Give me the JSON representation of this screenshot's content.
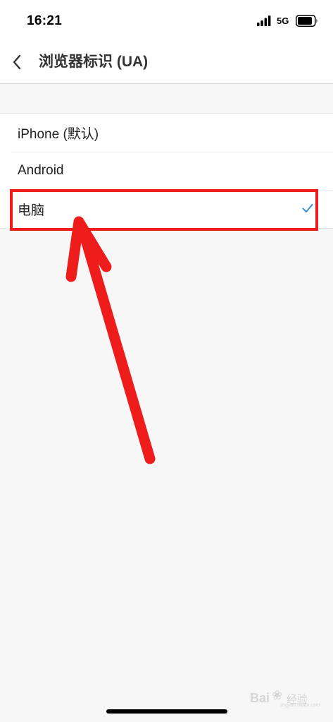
{
  "status_bar": {
    "time": "16:21",
    "network": "5G",
    "signal_icon": "cellular-signal-icon",
    "battery_icon": "battery-icon"
  },
  "nav": {
    "back_icon": "chevron-left-icon",
    "title": "浏览器标识 (UA)"
  },
  "options": [
    {
      "label": "iPhone (默认)",
      "selected": false
    },
    {
      "label": "Android",
      "selected": false
    },
    {
      "label": "电脑",
      "selected": true
    }
  ],
  "selected_icon": "checkmark-icon",
  "annotation": {
    "color": "#ef1c1c",
    "shapes": [
      "highlight-box",
      "arrow"
    ]
  },
  "watermark": {
    "brand": "Bai",
    "paw_icon": "paw-icon",
    "brand_cn": "经验",
    "url": "jingyan.baidu.com"
  },
  "colors": {
    "accent": "#3b8fe0",
    "annotation": "#ef1c1c",
    "background": "#f7f7f7"
  }
}
